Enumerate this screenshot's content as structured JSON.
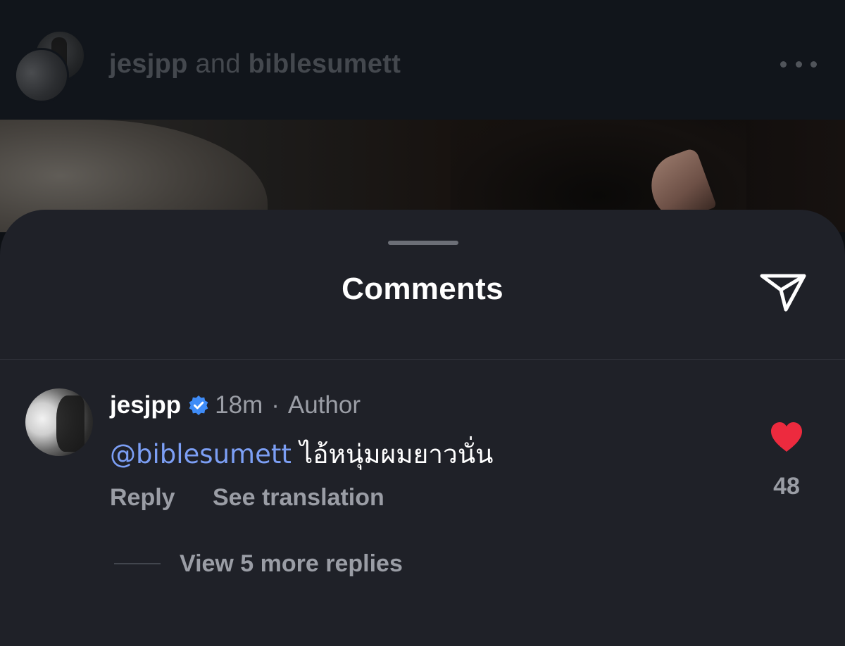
{
  "post_header": {
    "user1": "jesjpp",
    "connector": "and",
    "user2": "biblesumett",
    "more_icon": "ellipsis-horizontal-icon"
  },
  "sheet": {
    "title": "Comments",
    "share_icon": "paper-plane-icon"
  },
  "comment": {
    "username": "jesjpp",
    "verified_icon": "verified-badge-icon",
    "time": "18m",
    "separator": "·",
    "role": "Author",
    "mention": "@biblesumett",
    "text": "ไอ้หนุ่มผมยาวนั่น",
    "reply_label": "Reply",
    "translate_label": "See translation",
    "like_icon": "heart-filled-icon",
    "like_color": "#ed2a3e",
    "like_count": "48",
    "view_replies_label": "View 5 more replies"
  },
  "colors": {
    "sheet_bg": "#1f2128",
    "mention": "#7c9ff5",
    "verified": "#3f8cf7"
  }
}
